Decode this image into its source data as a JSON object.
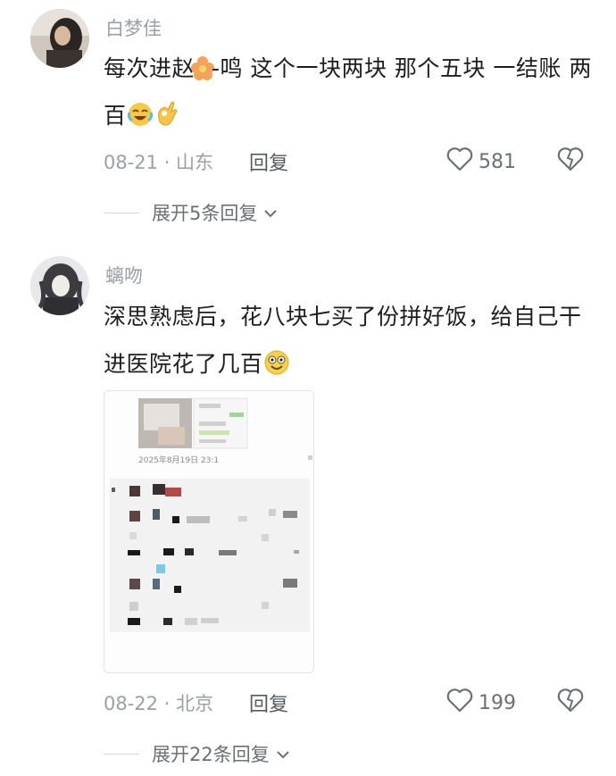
{
  "comments": [
    {
      "username": "白梦佳",
      "text_part1": "每次进赵",
      "text_part2": "-鸣 这个一块两块 那个五块 一结账 两百",
      "date_location": "08-21 · 山东",
      "reply_label": "回复",
      "likes": "581",
      "expand_label": "展开5条回复"
    },
    {
      "username": "螭吻",
      "text": "深思熟虑后，花八块七买了份拼好饭，给自己干进医院花了几百",
      "attachment_timestamp": "2025年8月19日 23:1",
      "date_location": "08-22 · 北京",
      "reply_label": "回复",
      "likes": "199",
      "expand_label": "展开22条回复"
    }
  ],
  "icons": {
    "heart": "heart-outline-icon",
    "dislike": "broken-heart-icon",
    "chevron": "chevron-down-icon"
  },
  "colors": {
    "text": "#1e1e1e",
    "meta": "#9aa0a6",
    "accent_green": "#5bc46a"
  }
}
